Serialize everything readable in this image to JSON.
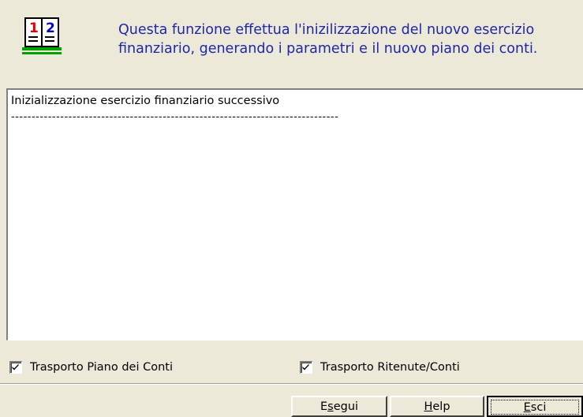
{
  "header": {
    "icon": "book-pages-icon",
    "line1": "Questa funzione effettua l'inizilizzazione del nuovo esercizio",
    "line2": "finanziario, generando i parametri e il nuovo piano dei conti.",
    "icon_numbers": [
      "1",
      "2"
    ]
  },
  "log": {
    "title": "Inizializzazione esercizio finanziario successivo",
    "separator": "--------------------------------------------------------------------------------"
  },
  "options": {
    "trasporto_piano": {
      "label": "Trasporto Piano dei Conti",
      "checked": true
    },
    "trasporto_ritenute": {
      "label": "Trasporto Ritenute/Conti",
      "checked": true
    }
  },
  "buttons": {
    "esegui": {
      "pre": "E",
      "accel": "s",
      "post": "egui"
    },
    "help": {
      "pre": "",
      "accel": "H",
      "post": "elp"
    },
    "esci": {
      "pre": "",
      "accel": "E",
      "post": "sci"
    }
  },
  "colors": {
    "header_text": "#1f27a8",
    "window_bg": "#ece9d8",
    "icon_red": "#e00000",
    "icon_blue": "#0000cc",
    "icon_green": "#00a000"
  }
}
